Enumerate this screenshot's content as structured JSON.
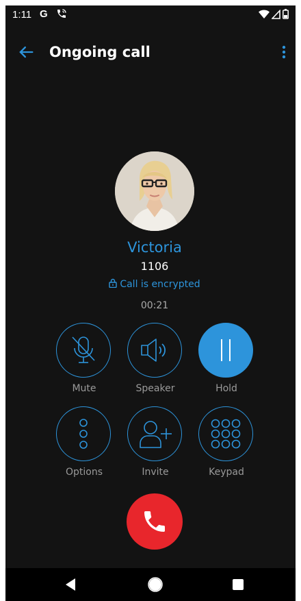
{
  "status_bar": {
    "time": "1:11",
    "google_glyph": "G",
    "icons": [
      "google-icon",
      "call-active-icon",
      "wifi-icon",
      "signal-icon",
      "battery-icon"
    ]
  },
  "app_bar": {
    "title": "Ongoing call",
    "back_icon": "arrow-back-icon",
    "menu_icon": "more-vertical-icon"
  },
  "contact": {
    "name": "Victoria",
    "number": "1106",
    "encryption_text": "Call is encrypted",
    "duration": "00:21"
  },
  "controls": {
    "mute": "Mute",
    "speaker": "Speaker",
    "hold": "Hold",
    "options": "Options",
    "invite": "Invite",
    "keypad": "Keypad"
  },
  "colors": {
    "background": "#131313",
    "accent": "#2d94db",
    "end_call": "#e8262c",
    "label": "#9a9a9a"
  }
}
